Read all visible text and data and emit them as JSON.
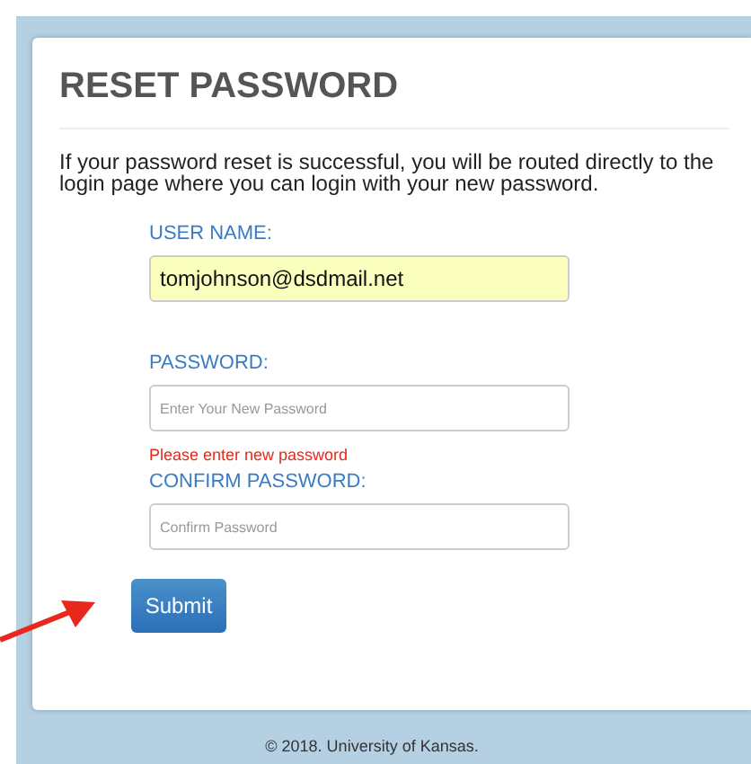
{
  "card": {
    "title": "RESET PASSWORD",
    "intro": "If your password reset is successful, you will be routed directly to the login page where you can login with your new password.",
    "fields": [
      {
        "label": "USER NAME:",
        "value": "tomjohnson@dsdmail.net",
        "autofilled": true
      },
      {
        "label": "PASSWORD:",
        "placeholder": "Enter Your New Password",
        "autofilled": false,
        "error": "Please enter new password"
      },
      {
        "label": "CONFIRM PASSWORD:",
        "placeholder": "Confirm Password",
        "autofilled": false
      }
    ],
    "submit": "Submit"
  },
  "footer": "© 2018. University of Kansas."
}
